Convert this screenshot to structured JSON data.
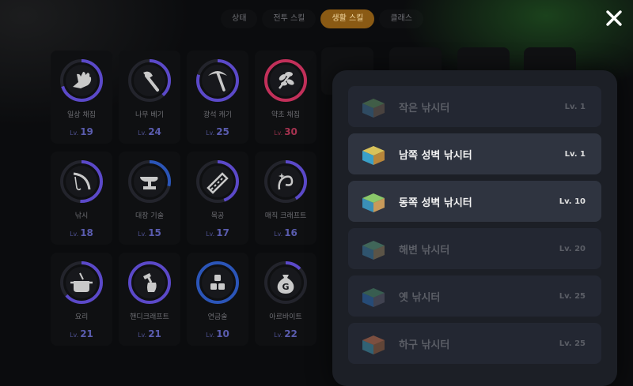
{
  "tabs": [
    {
      "label": "상태"
    },
    {
      "label": "전투 스킬"
    },
    {
      "label": "생활 스킬"
    },
    {
      "label": "클래스"
    }
  ],
  "active_tab": "생활 스킬",
  "lv_prefix": "Lv.",
  "skills": [
    {
      "name": "일상 채집",
      "level": "19",
      "icon": "hand-gather-icon"
    },
    {
      "name": "나무 베기",
      "level": "24",
      "icon": "axe-icon"
    },
    {
      "name": "광석 캐기",
      "level": "25",
      "icon": "pickaxe-icon"
    },
    {
      "name": "약초 채집",
      "level": "30",
      "icon": "herb-icon",
      "accent": "#c2305a"
    },
    {
      "name": "낚시",
      "level": "18",
      "icon": "fishing-rod-icon"
    },
    {
      "name": "대장 기술",
      "level": "15",
      "icon": "anvil-icon"
    },
    {
      "name": "목공",
      "level": "17",
      "icon": "saw-icon"
    },
    {
      "name": "매직 크래프트",
      "level": "16",
      "icon": "magic-icon"
    },
    {
      "name": "요리",
      "level": "21",
      "icon": "cooking-pot-icon"
    },
    {
      "name": "핸디크래프트",
      "level": "21",
      "icon": "hammer-fist-icon"
    },
    {
      "name": "연금술",
      "level": "10",
      "icon": "alchemy-blocks-icon"
    },
    {
      "name": "아르바이트",
      "level": "22",
      "icon": "money-bag-icon"
    }
  ],
  "fishing_spots": [
    {
      "name": "작은 낚시터",
      "level": "Lv. 1",
      "state": "dim"
    },
    {
      "name": "남쪽 성벽 낚시터",
      "level": "Lv. 1",
      "state": "active"
    },
    {
      "name": "동쪽 성벽 낚시터",
      "level": "Lv. 10",
      "state": "active"
    },
    {
      "name": "해변 낚시터",
      "level": "Lv. 20",
      "state": "dim"
    },
    {
      "name": "옛 낚시터",
      "level": "Lv. 25",
      "state": "dim"
    },
    {
      "name": "하구 낚시터",
      "level": "Lv. 25",
      "state": "dim"
    }
  ],
  "colors": {
    "ring_purple": "#5b49c9",
    "ring_red": "#c2305a",
    "ring_blue": "#2b55b8",
    "active_tab": "#8a5a14"
  }
}
